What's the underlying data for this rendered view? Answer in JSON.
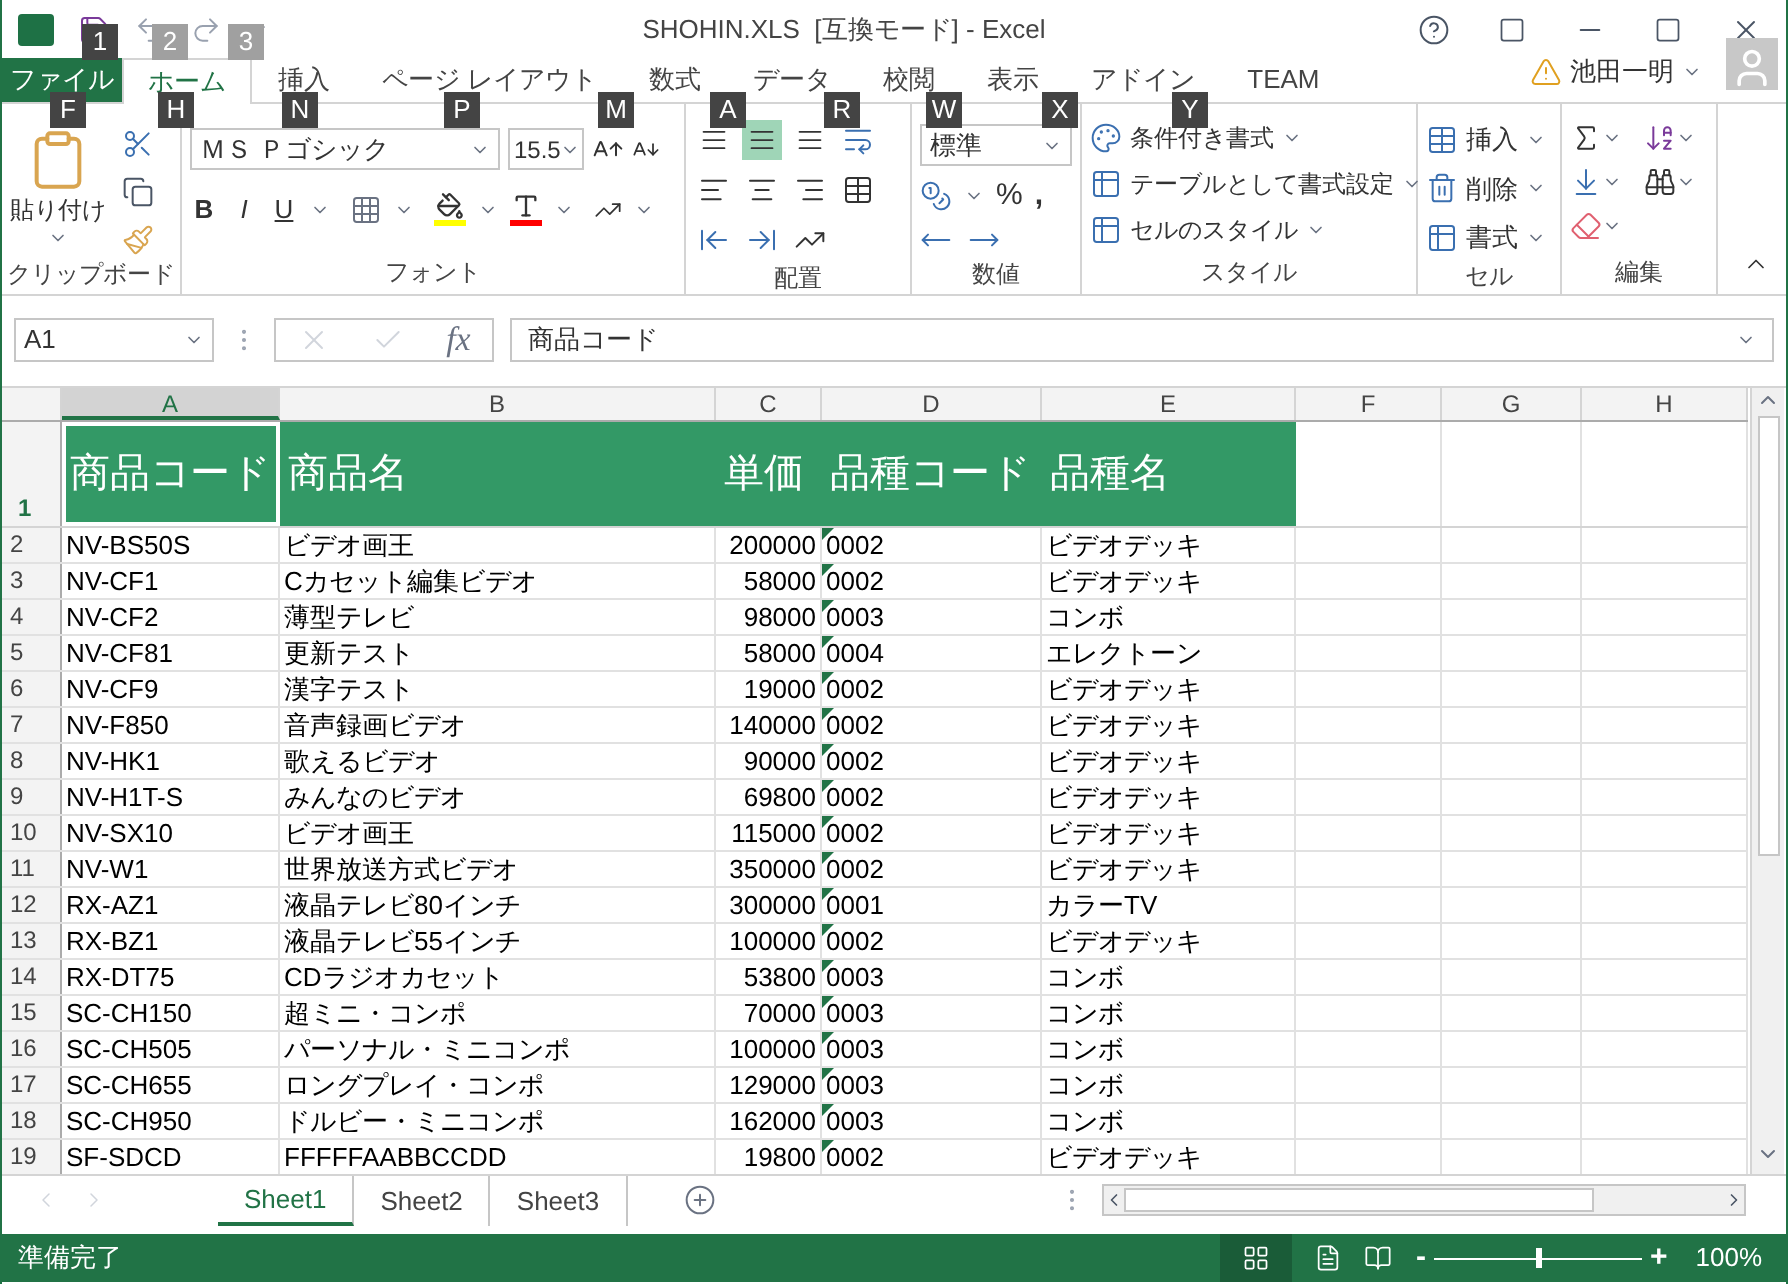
{
  "title_bar": {
    "title": "SHOHIN.XLS  [互換モード] - Excel",
    "key_tips": [
      "1",
      "2",
      "3"
    ]
  },
  "ribbon_tabs": [
    {
      "label": "ファイル",
      "kind": "file",
      "selected": false
    },
    {
      "label": "ホーム",
      "kind": "tab",
      "selected": true
    },
    {
      "label": "挿入",
      "kind": "tab",
      "selected": false
    },
    {
      "label": "ページ レイアウト",
      "kind": "tab",
      "selected": false
    },
    {
      "label": "数式",
      "kind": "tab",
      "selected": false
    },
    {
      "label": "データ",
      "kind": "tab",
      "selected": false
    },
    {
      "label": "校閲",
      "kind": "tab",
      "selected": false
    },
    {
      "label": "表示",
      "kind": "tab",
      "selected": false
    },
    {
      "label": "アドイン",
      "kind": "tab",
      "selected": false
    },
    {
      "label": "TEAM",
      "kind": "tab",
      "selected": false
    }
  ],
  "key_tips": [
    "F",
    "H",
    "N",
    "P",
    "M",
    "A",
    "R",
    "W",
    "X",
    "Y"
  ],
  "account": {
    "user": "池田一明"
  },
  "ribbon": {
    "clipboard": {
      "label": "クリップボード",
      "paste": "貼り付け"
    },
    "font": {
      "label": "フォント",
      "font_name": "ＭＳ Ｐゴシック",
      "font_size": "15.5",
      "bold": "B",
      "italic": "I",
      "underline": "U"
    },
    "alignment": {
      "label": "配置",
      "vertical_align": [
        {
          "selected": false
        },
        {
          "selected": true
        },
        {
          "selected": false
        }
      ]
    },
    "number": {
      "label": "数値",
      "format": "標準",
      "percent": "%",
      "comma": ","
    },
    "styles": {
      "label": "スタイル",
      "items": [
        "条件付き書式",
        "テーブルとして書式設定",
        "セルのスタイル"
      ]
    },
    "cells": {
      "label": "セル",
      "items": [
        "挿入",
        "削除",
        "書式"
      ]
    },
    "editing": {
      "label": "編集"
    }
  },
  "formula_bar": {
    "name_box": "A1",
    "fx": "fx",
    "value": "商品コード"
  },
  "sheet": {
    "columns": [
      {
        "label": "A",
        "selected": true,
        "flagged": false
      },
      {
        "label": "B",
        "selected": false,
        "flagged": false
      },
      {
        "label": "C",
        "selected": false,
        "flagged": false
      },
      {
        "label": "D",
        "selected": false,
        "flagged": true
      },
      {
        "label": "E",
        "selected": false,
        "flagged": false
      },
      {
        "label": "F",
        "selected": false,
        "flagged": false
      },
      {
        "label": "G",
        "selected": false,
        "flagged": false
      },
      {
        "label": "H",
        "selected": false,
        "flagged": false
      }
    ],
    "header_row": {
      "row": "1",
      "cells": [
        {
          "text": "商品コード",
          "selected": true
        },
        {
          "text": "商品名",
          "selected": false
        },
        {
          "text": "単価",
          "selected": false
        },
        {
          "text": "品種コード",
          "selected": false
        },
        {
          "text": "品種名",
          "selected": false
        }
      ]
    },
    "rows": [
      {
        "row": "2",
        "cells": [
          "NV-BS50S",
          "ビデオ画王",
          "200000",
          "0002",
          "ビデオデッキ"
        ]
      },
      {
        "row": "3",
        "cells": [
          "NV-CF1",
          "Cカセット編集ビデオ",
          "58000",
          "0002",
          "ビデオデッキ"
        ]
      },
      {
        "row": "4",
        "cells": [
          "NV-CF2",
          "薄型テレビ",
          "98000",
          "0003",
          "コンボ"
        ]
      },
      {
        "row": "5",
        "cells": [
          "NV-CF81",
          "更新テスト",
          "58000",
          "0004",
          "エレクトーン"
        ]
      },
      {
        "row": "6",
        "cells": [
          "NV-CF9",
          "漢字テスト",
          "19000",
          "0002",
          "ビデオデッキ"
        ]
      },
      {
        "row": "7",
        "cells": [
          "NV-F850",
          "音声録画ビデオ",
          "140000",
          "0002",
          "ビデオデッキ"
        ]
      },
      {
        "row": "8",
        "cells": [
          "NV-HK1",
          "歌えるビデオ",
          "90000",
          "0002",
          "ビデオデッキ"
        ]
      },
      {
        "row": "9",
        "cells": [
          "NV-H1T-S",
          "みんなのビデオ",
          "69800",
          "0002",
          "ビデオデッキ"
        ]
      },
      {
        "row": "10",
        "cells": [
          "NV-SX10",
          "ビデオ画王",
          "115000",
          "0002",
          "ビデオデッキ"
        ]
      },
      {
        "row": "11",
        "cells": [
          "NV-W1",
          "世界放送方式ビデオ",
          "350000",
          "0002",
          "ビデオデッキ"
        ]
      },
      {
        "row": "12",
        "cells": [
          "RX-AZ1",
          "液晶テレビ80インチ",
          "300000",
          "0001",
          "カラーTV"
        ]
      },
      {
        "row": "13",
        "cells": [
          "RX-BZ1",
          "液晶テレビ55インチ",
          "100000",
          "0002",
          "ビデオデッキ"
        ]
      },
      {
        "row": "14",
        "cells": [
          "RX-DT75",
          "CDラジオカセット",
          "53800",
          "0003",
          "コンボ"
        ]
      },
      {
        "row": "15",
        "cells": [
          "SC-CH150",
          "超ミニ・コンポ",
          "70000",
          "0003",
          "コンボ"
        ]
      },
      {
        "row": "16",
        "cells": [
          "SC-CH505",
          "パーソナル・ミニコンポ",
          "100000",
          "0003",
          "コンボ"
        ]
      },
      {
        "row": "17",
        "cells": [
          "SC-CH655",
          "ロングプレイ・コンポ",
          "129000",
          "0003",
          "コンボ"
        ]
      },
      {
        "row": "18",
        "cells": [
          "SC-CH950",
          "ドルビー・ミニコンポ",
          "162000",
          "0003",
          "コンボ"
        ]
      },
      {
        "row": "19",
        "cells": [
          "SF-SDCD",
          "FFFFFAABBCCDD",
          "19800",
          "0002",
          "ビデオデッキ"
        ]
      }
    ]
  },
  "sheet_tabs": [
    {
      "label": "Sheet1",
      "selected": true
    },
    {
      "label": "Sheet2",
      "selected": false
    },
    {
      "label": "Sheet3",
      "selected": false
    }
  ],
  "status_bar": {
    "text": "準備完了",
    "zoom_out": "-",
    "zoom_in": "+",
    "zoom": {
      "level": 0.5
    },
    "zoom_label": "100%"
  }
}
